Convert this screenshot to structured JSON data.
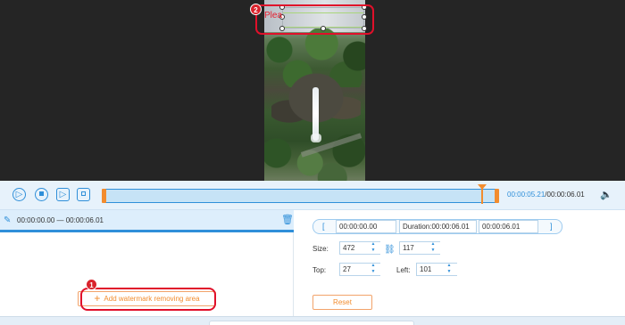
{
  "preview": {
    "watermark_text": "Plea",
    "step2_badge": "2"
  },
  "playback": {
    "play_icon": "play-icon",
    "stop_icon": "stop-icon",
    "next_frame_icon": "next-frame-icon",
    "fullscreen_icon": "fullscreen-icon",
    "current_time": "00:00:05.21",
    "total_time": "/00:00:06.01",
    "volume_icon": "volume-icon"
  },
  "area_list": {
    "items": [
      {
        "range": "00:00:00.00 — 00:00:06.01"
      }
    ],
    "pen_icon": "pen-icon",
    "delete_icon": "trash-icon",
    "add_button_label": "Add watermark removing area",
    "step1_badge": "1"
  },
  "settings": {
    "start_time": "00:00:00.00",
    "duration": "Duration:00:00:06.01",
    "end_time": "00:00:06.01",
    "size_label": "Size:",
    "width": "472",
    "height": "117",
    "top_label": "Top:",
    "top": "27",
    "left_label": "Left:",
    "left": "101",
    "reset_label": "Reset",
    "link_icon": "link-icon"
  },
  "colors": {
    "accent": "#2f8fd9",
    "orange": "#f28c2e",
    "highlight_red": "#e0102a"
  }
}
